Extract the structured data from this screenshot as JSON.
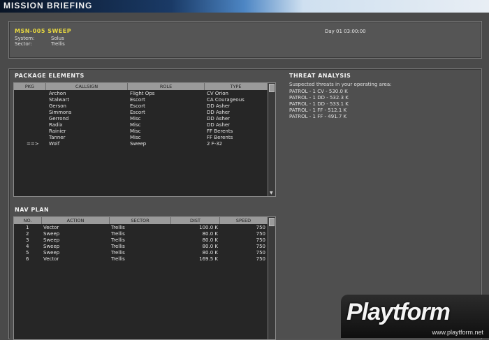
{
  "window": {
    "title": "MISSION BRIEFING"
  },
  "header": {
    "mission_name": "MSN-005 SWEEP",
    "system_label": "System:",
    "system_value": "Solus",
    "sector_label": "Sector:",
    "sector_value": "Trellis",
    "day_time": "Day 01 03:00:00"
  },
  "package": {
    "label": "PACKAGE ELEMENTS",
    "columns": [
      "PKG",
      "CALLSIGN",
      "ROLE",
      "TYPE"
    ],
    "rows": [
      {
        "pkg": "",
        "callsign": "Archon",
        "role": "Flight Ops",
        "type": "CV Orion"
      },
      {
        "pkg": "",
        "callsign": "Stalwart",
        "role": "Escort",
        "type": "CA Courageous"
      },
      {
        "pkg": "",
        "callsign": "Gerson",
        "role": "Escort",
        "type": "DD Asher"
      },
      {
        "pkg": "",
        "callsign": "Simmons",
        "role": "Escort",
        "type": "DD Asher"
      },
      {
        "pkg": "",
        "callsign": "Gerrond",
        "role": "Misc",
        "type": "DD Asher"
      },
      {
        "pkg": "",
        "callsign": "Radix",
        "role": "Misc",
        "type": "DD Asher"
      },
      {
        "pkg": "",
        "callsign": "Rainier",
        "role": "Misc",
        "type": "FF Berents"
      },
      {
        "pkg": "",
        "callsign": "Tanner",
        "role": "Misc",
        "type": "FF Berents"
      },
      {
        "pkg": "==>",
        "callsign": "Wolf",
        "role": "Sweep",
        "type": "2 F-32"
      }
    ]
  },
  "navplan": {
    "label": "NAV PLAN",
    "columns": [
      "NO.",
      "ACTION",
      "SECTOR",
      "DIST",
      "SPEED"
    ],
    "rows": [
      {
        "no": "1",
        "action": "Vector",
        "sector": "Trellis",
        "dist": "100.0 K",
        "speed": "750"
      },
      {
        "no": "2",
        "action": "Sweep",
        "sector": "Trellis",
        "dist": "80.0 K",
        "speed": "750"
      },
      {
        "no": "3",
        "action": "Sweep",
        "sector": "Trellis",
        "dist": "80.0 K",
        "speed": "750"
      },
      {
        "no": "4",
        "action": "Sweep",
        "sector": "Trellis",
        "dist": "80.0 K",
        "speed": "750"
      },
      {
        "no": "5",
        "action": "Sweep",
        "sector": "Trellis",
        "dist": "80.0 K",
        "speed": "750"
      },
      {
        "no": "6",
        "action": "Vector",
        "sector": "Trellis",
        "dist": "169.5 K",
        "speed": "750"
      }
    ]
  },
  "threat": {
    "label": "THREAT ANALYSIS",
    "subtitle": "Suspected threats in your operating area:",
    "items": [
      "PATROL - 1 CV - 530.0 K",
      "PATROL - 1 DD - 532.3 K",
      "PATROL - 1 DD - 533.1 K",
      "PATROL - 1 FF - 512.1 K",
      "PATROL - 1 FF - 491.7 K"
    ]
  },
  "watermark": {
    "logo": "Playtform",
    "url": "www.playtform.net"
  }
}
